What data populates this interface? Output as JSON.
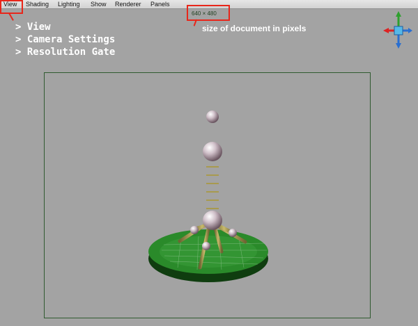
{
  "menu": {
    "items": [
      "View",
      "Shading",
      "Lighting",
      "Show",
      "Renderer",
      "Panels"
    ]
  },
  "viewport": {
    "resolution_label": "640 × 480",
    "annotation": "size of document in pixels"
  },
  "steps": [
    "> View",
    "> Camera Settings",
    "> Resolution Gate"
  ],
  "colors": {
    "highlight": "#e8261a",
    "gate": "#2f5a2f",
    "viewport_bg": "#a3a3a3"
  },
  "icons": [
    "axis-gizmo-icon"
  ]
}
